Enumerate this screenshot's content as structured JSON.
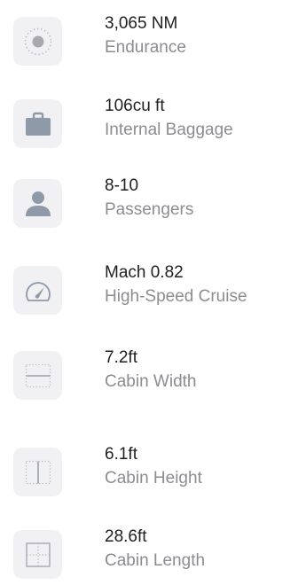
{
  "specs": [
    {
      "value": "3,065 NM",
      "label": "Endurance",
      "icon": "globe-icon"
    },
    {
      "value": "106cu ft",
      "label": "Internal Baggage",
      "icon": "briefcase-icon"
    },
    {
      "value": "8-10",
      "label": "Passengers",
      "icon": "person-icon"
    },
    {
      "value": "Mach 0.82",
      "label": "High-Speed Cruise",
      "icon": "speedometer-icon"
    },
    {
      "value": "7.2ft",
      "label": "Cabin Width",
      "icon": "cabin-width-icon"
    },
    {
      "value": "6.1ft",
      "label": "Cabin Height",
      "icon": "cabin-height-icon"
    },
    {
      "value": "28.6ft",
      "label": "Cabin Length",
      "icon": "cabin-length-icon"
    }
  ]
}
